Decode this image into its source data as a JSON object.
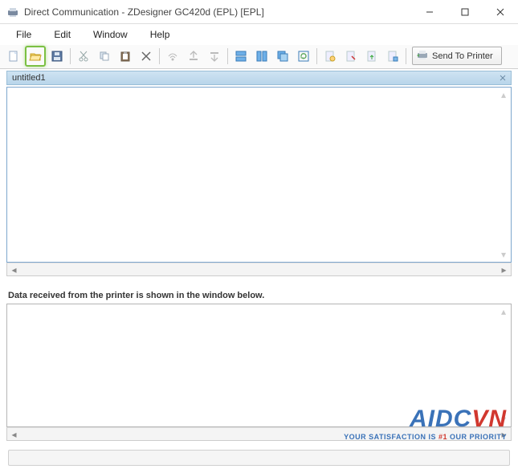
{
  "window": {
    "title": "Direct Communication - ZDesigner GC420d (EPL) [EPL]"
  },
  "menu": {
    "file": "File",
    "edit": "Edit",
    "window": "Window",
    "help": "Help"
  },
  "toolbar": {
    "send_to_printer": "Send To Printer"
  },
  "document": {
    "tab_name": "untitled1"
  },
  "status": {
    "recv_label": "Data received from the printer is shown in the window below."
  },
  "watermark": {
    "brand_a": "AIDC",
    "brand_b": "VN",
    "tagline_pre": "YOUR SATISFACTION IS ",
    "tagline_hl": "#1",
    "tagline_post": " OUR PRIORITY"
  }
}
